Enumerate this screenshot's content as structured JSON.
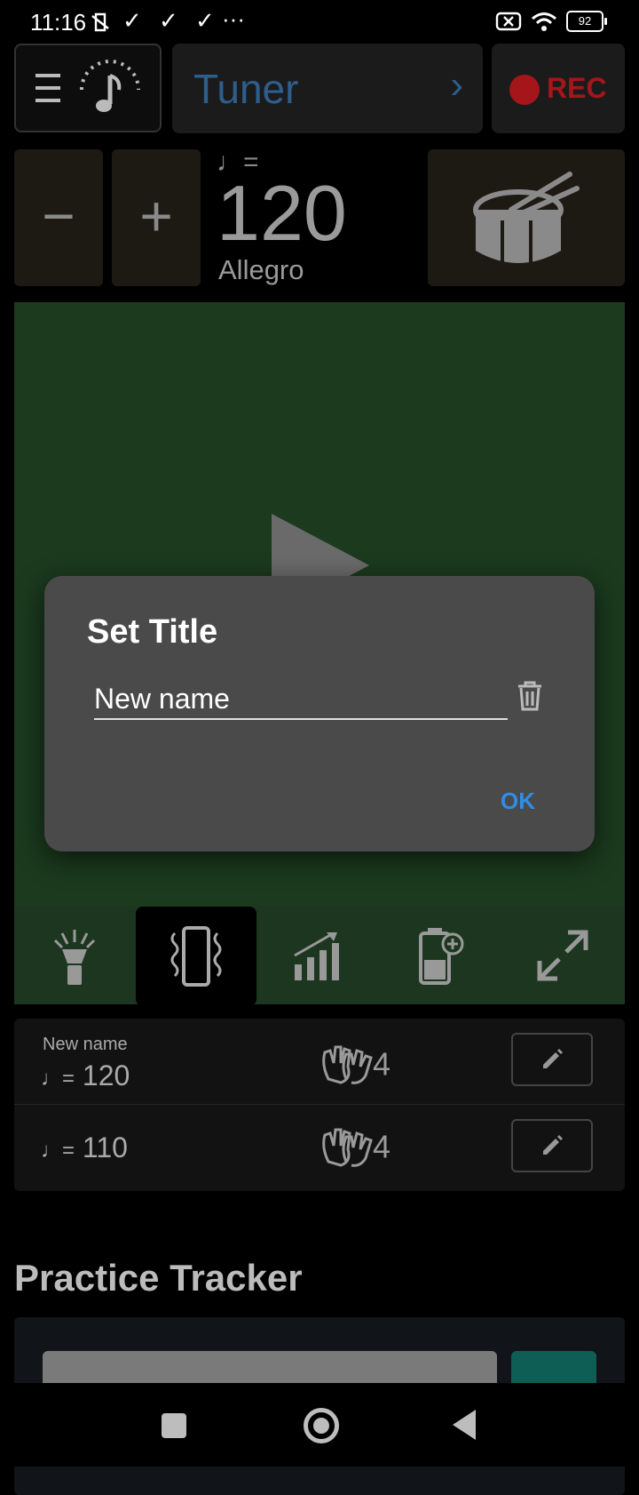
{
  "status_bar": {
    "time": "11:16",
    "glyphs": "✓ ✓ ✓",
    "more": "···",
    "battery": "92"
  },
  "header": {
    "tuner_label": "Tuner",
    "rec_label": "REC"
  },
  "tempo": {
    "decrease_label": "−",
    "increase_label": "+",
    "note_equals": "♩=",
    "bpm": "120",
    "tempo_name": "Allegro"
  },
  "list": {
    "rows": [
      {
        "name": "New name",
        "note_equals": "♩=",
        "bpm": "120",
        "beats": "4"
      },
      {
        "name": "",
        "note_equals": "♩=",
        "bpm": "110",
        "beats": "4"
      }
    ]
  },
  "practice": {
    "title": "Practice Tracker"
  },
  "dialog": {
    "title": "Set Title",
    "input_value": "New name",
    "ok_label": "OK"
  },
  "colors": {
    "accent_blue": "#2f8de4",
    "rec_red": "#a4161a",
    "green_bg": "#1b3a1e",
    "tuner_blue": "#2d5e8c"
  }
}
